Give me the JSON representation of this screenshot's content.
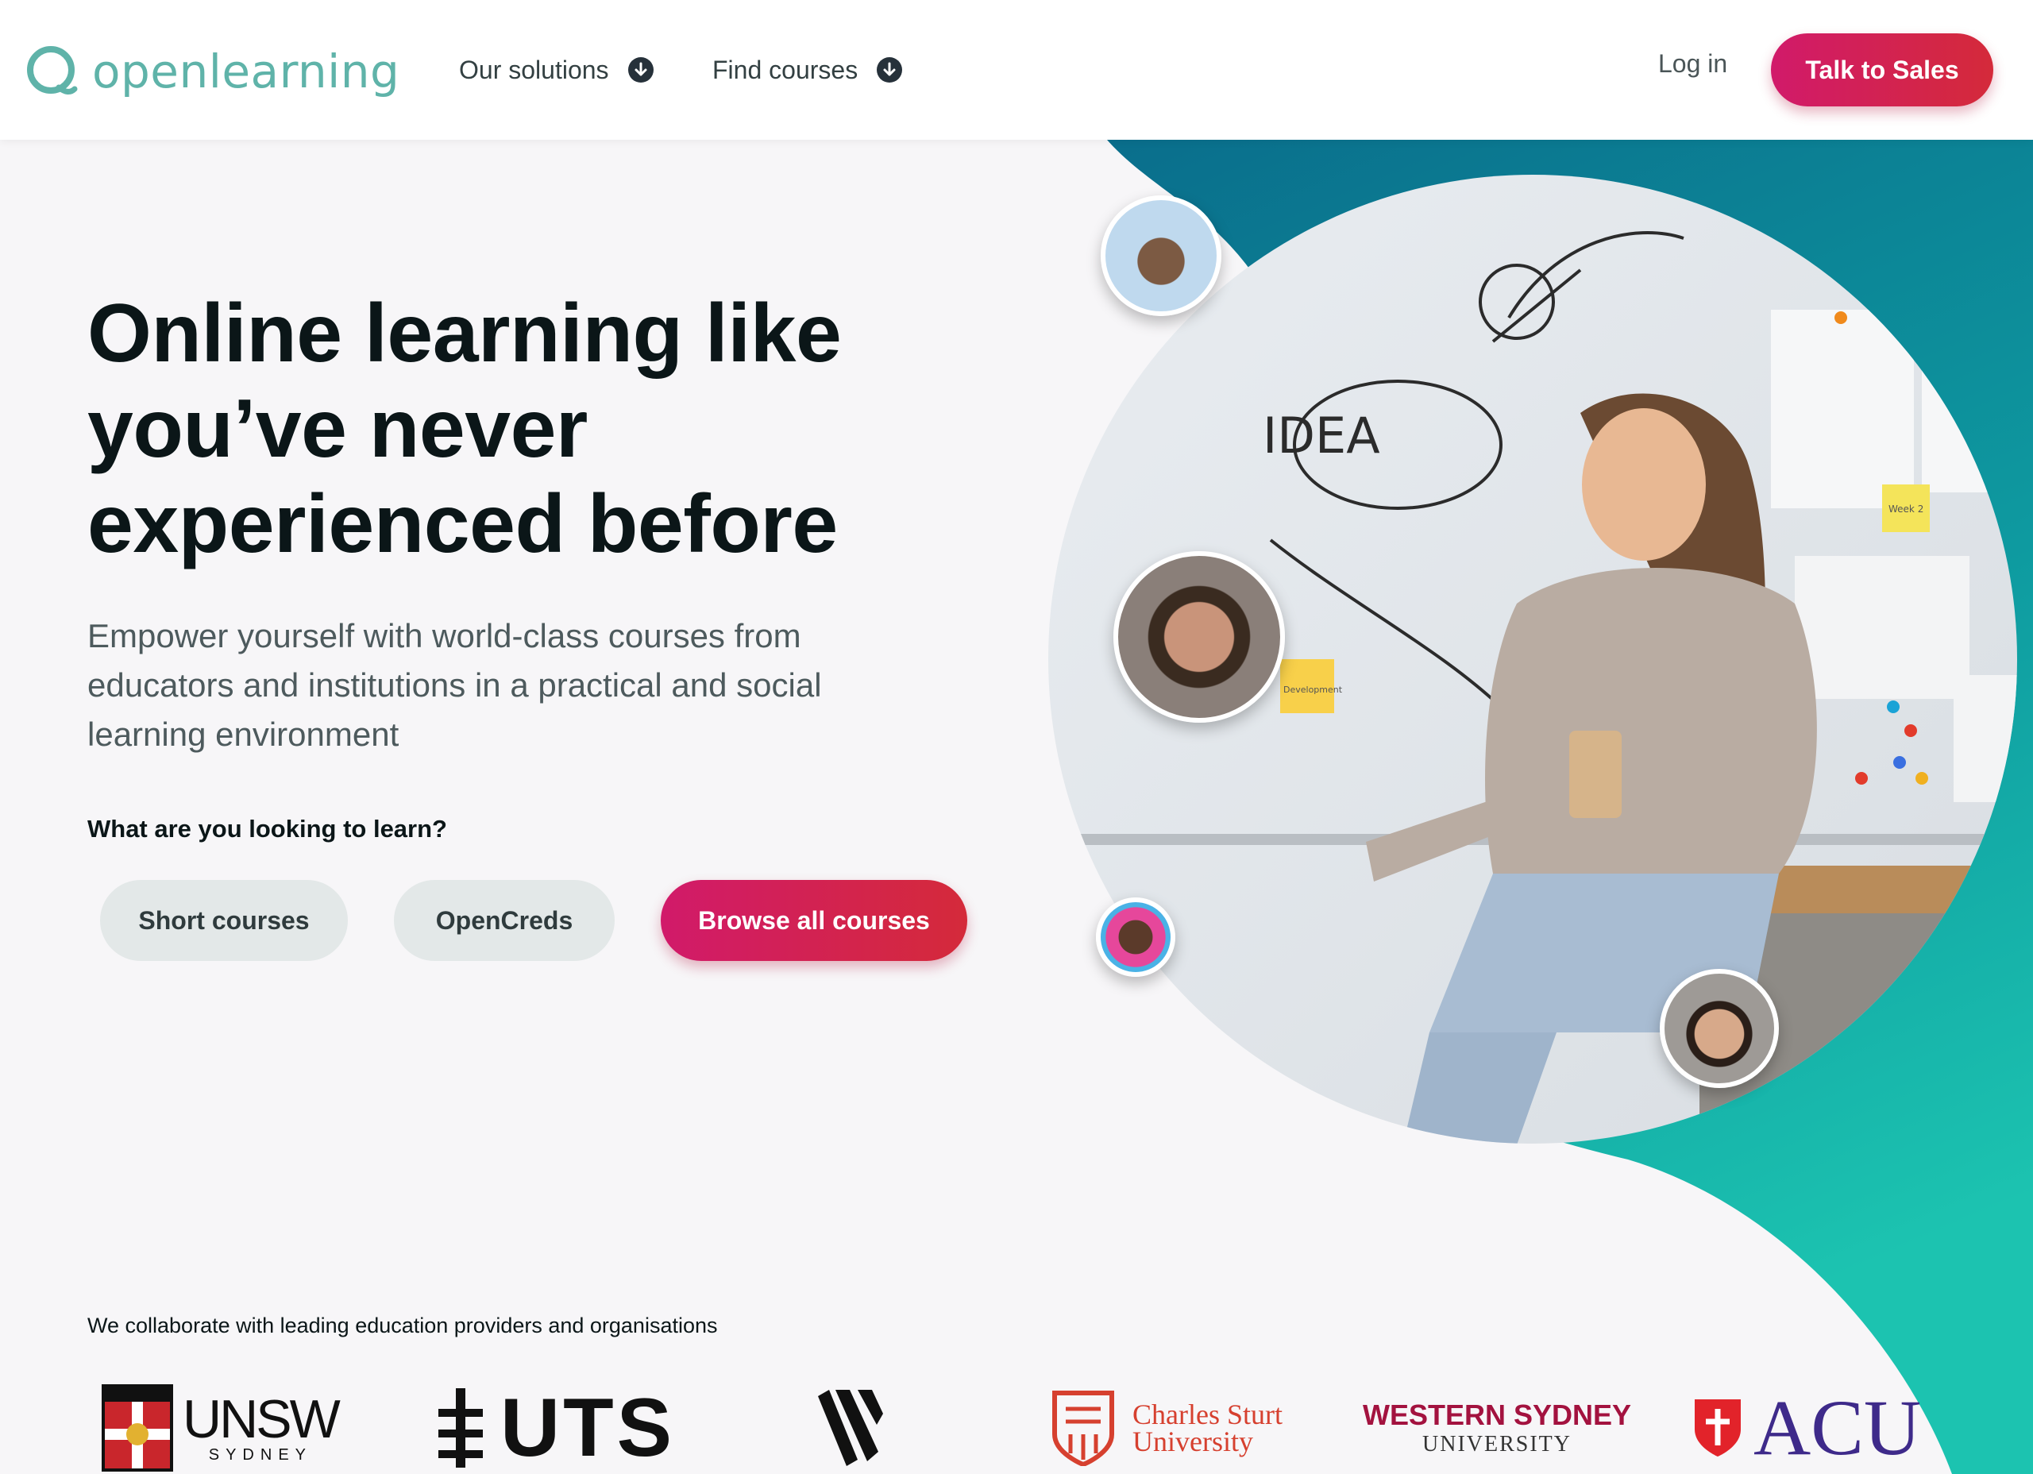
{
  "header": {
    "logo_text": "openlearning",
    "nav": [
      {
        "label": "Our solutions",
        "icon": "arrow-down-circle-icon"
      },
      {
        "label": "Find courses",
        "icon": "arrow-down-circle-icon"
      }
    ],
    "login_label": "Log in",
    "cta_label": "Talk to Sales"
  },
  "hero": {
    "title_lines": [
      "Online learning like",
      "you’ve never",
      "experienced before"
    ],
    "subtitle": "Empower yourself with world-class courses from educators and institutions in a practical and social learning environment",
    "question": "What are you looking to learn?",
    "buttons": {
      "short": "Short courses",
      "opencreds": "OpenCreds",
      "browse": "Browse all courses"
    },
    "photo_text": {
      "whiteboard": "IDEA",
      "sticky_note_left": "Development",
      "sticky_note_right": "Week 2"
    }
  },
  "partners": {
    "heading": "We collaborate with leading education providers and organisations",
    "logos": [
      {
        "name": "UNSW",
        "sub": "SYDNEY"
      },
      {
        "name": "UTS"
      },
      {
        "name": "partner-mark"
      },
      {
        "name": "Charles Sturt",
        "sub": "University"
      },
      {
        "name": "WESTERN SYDNEY",
        "sub": "UNIVERSITY"
      },
      {
        "name": "ACU"
      }
    ]
  },
  "colors": {
    "brand_teal": "#5fb3a9",
    "cta_pink": "#d11a6a",
    "teal_dark": "#0b6f8a",
    "teal_light": "#1fc0ad"
  }
}
